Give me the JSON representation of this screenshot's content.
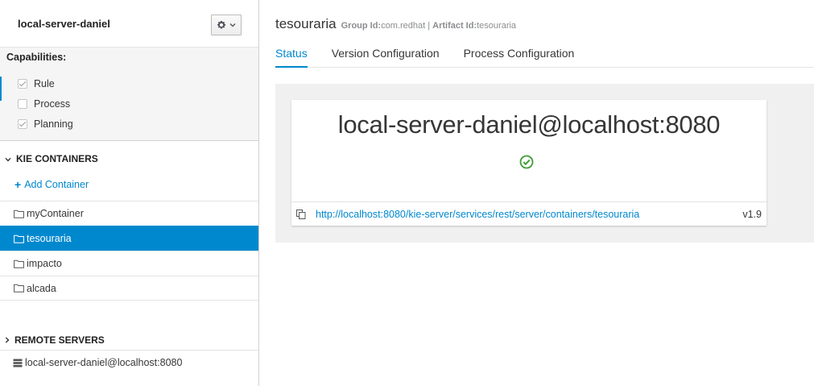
{
  "server": {
    "name": "local-server-daniel",
    "menu_icon": "gear-icon"
  },
  "capabilities": {
    "title": "Capabilities:",
    "items": [
      {
        "label": "Rule",
        "checked": true
      },
      {
        "label": "Process",
        "checked": false
      },
      {
        "label": "Planning",
        "checked": true
      }
    ]
  },
  "kie_containers": {
    "title": "KIE CONTAINERS",
    "add_label": "Add Container",
    "items": [
      {
        "label": "myContainer",
        "active": false
      },
      {
        "label": "tesouraria",
        "active": true
      },
      {
        "label": "impacto",
        "active": false
      },
      {
        "label": "alcada",
        "active": false
      }
    ]
  },
  "remote_servers": {
    "title": "REMOTE SERVERS",
    "items": [
      {
        "label": "local-server-daniel@localhost:8080"
      }
    ]
  },
  "container": {
    "title": "tesouraria",
    "group_id_label": "Group Id:",
    "group_id": "com.redhat",
    "separator": "|",
    "artifact_id_label": "Artifact Id:",
    "artifact_id": "tesouraria"
  },
  "tabs": [
    {
      "label": "Status",
      "active": true
    },
    {
      "label": "Version Configuration",
      "active": false
    },
    {
      "label": "Process Configuration",
      "active": false
    }
  ],
  "status_card": {
    "host": "local-server-daniel@localhost:8080",
    "status_icon": "ok-circle-icon",
    "url": "http://localhost:8080/kie-server/services/rest/server/containers/tesouraria",
    "version": "v1.9"
  },
  "colors": {
    "accent": "#0088ce",
    "success": "#3f9c35"
  }
}
